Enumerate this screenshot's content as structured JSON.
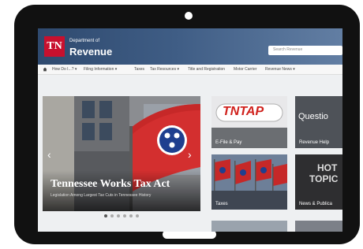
{
  "header": {
    "logo_text": "TN",
    "dept_label": "Department of",
    "title": "Revenue",
    "search_placeholder": "Search Revenue"
  },
  "nav": {
    "home_icon": "home-icon",
    "items": [
      "How Do I...? ▾",
      "Filing Information ▾",
      "Taxes",
      "Tax Resources ▾",
      "Title and Registration",
      "Motor Carrier",
      "Revenue News ▾"
    ]
  },
  "hero": {
    "title": "Tennessee Works Tax Act",
    "subtitle": "Legislation Among Largest Tax Cuts in Tennessee History",
    "prev_icon": "chevron-left-icon",
    "next_icon": "chevron-right-icon"
  },
  "tiles": {
    "tntap_logo": "TNTAP",
    "tntap_label": "E-File & Pay",
    "questions_title": "Questio",
    "questions_label": "Revenue Help",
    "taxes_label": "Taxes",
    "hot_topics_title_1": "HOT",
    "hot_topics_title_2": "TOPIC",
    "hot_topics_label": "News & Publica"
  },
  "colors": {
    "header_blue": "#2f4a6f",
    "tn_red": "#c8102e",
    "tntap_red": "#d0211c",
    "questions_dark": "#4e5258"
  }
}
